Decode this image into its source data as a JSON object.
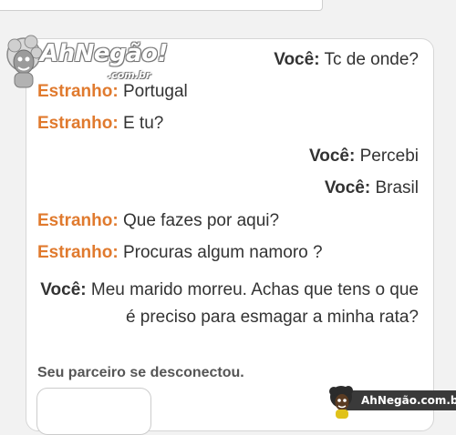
{
  "watermark": {
    "logo_main": "AhNegão!",
    "logo_sub": ".com.br",
    "badge_text": "AhNegão.com.br"
  },
  "messages": [
    {
      "sender": "Você:",
      "text": "Tc de onde?",
      "side": "right"
    },
    {
      "sender": "Estranho:",
      "text": "Portugal",
      "side": "left"
    },
    {
      "sender": "Estranho:",
      "text": "E tu?",
      "side": "left"
    },
    {
      "sender": "Você:",
      "text": "Percebi",
      "side": "right"
    },
    {
      "sender": "Você:",
      "text": "Brasil",
      "side": "right"
    },
    {
      "sender": "Estranho:",
      "text": "Que fazes por aqui?",
      "side": "left"
    },
    {
      "sender": "Estranho:",
      "text": "Procuras algum namoro ?",
      "side": "left"
    },
    {
      "sender": "Você:",
      "text": "Meu marido morreu. Achas que tens o que é preciso para esmagar a minha rata?",
      "side": "right"
    }
  ],
  "status": "Seu parceiro se desconectou.",
  "colors": {
    "stranger": "#e07a2e",
    "you": "#333333",
    "status": "#555555"
  }
}
